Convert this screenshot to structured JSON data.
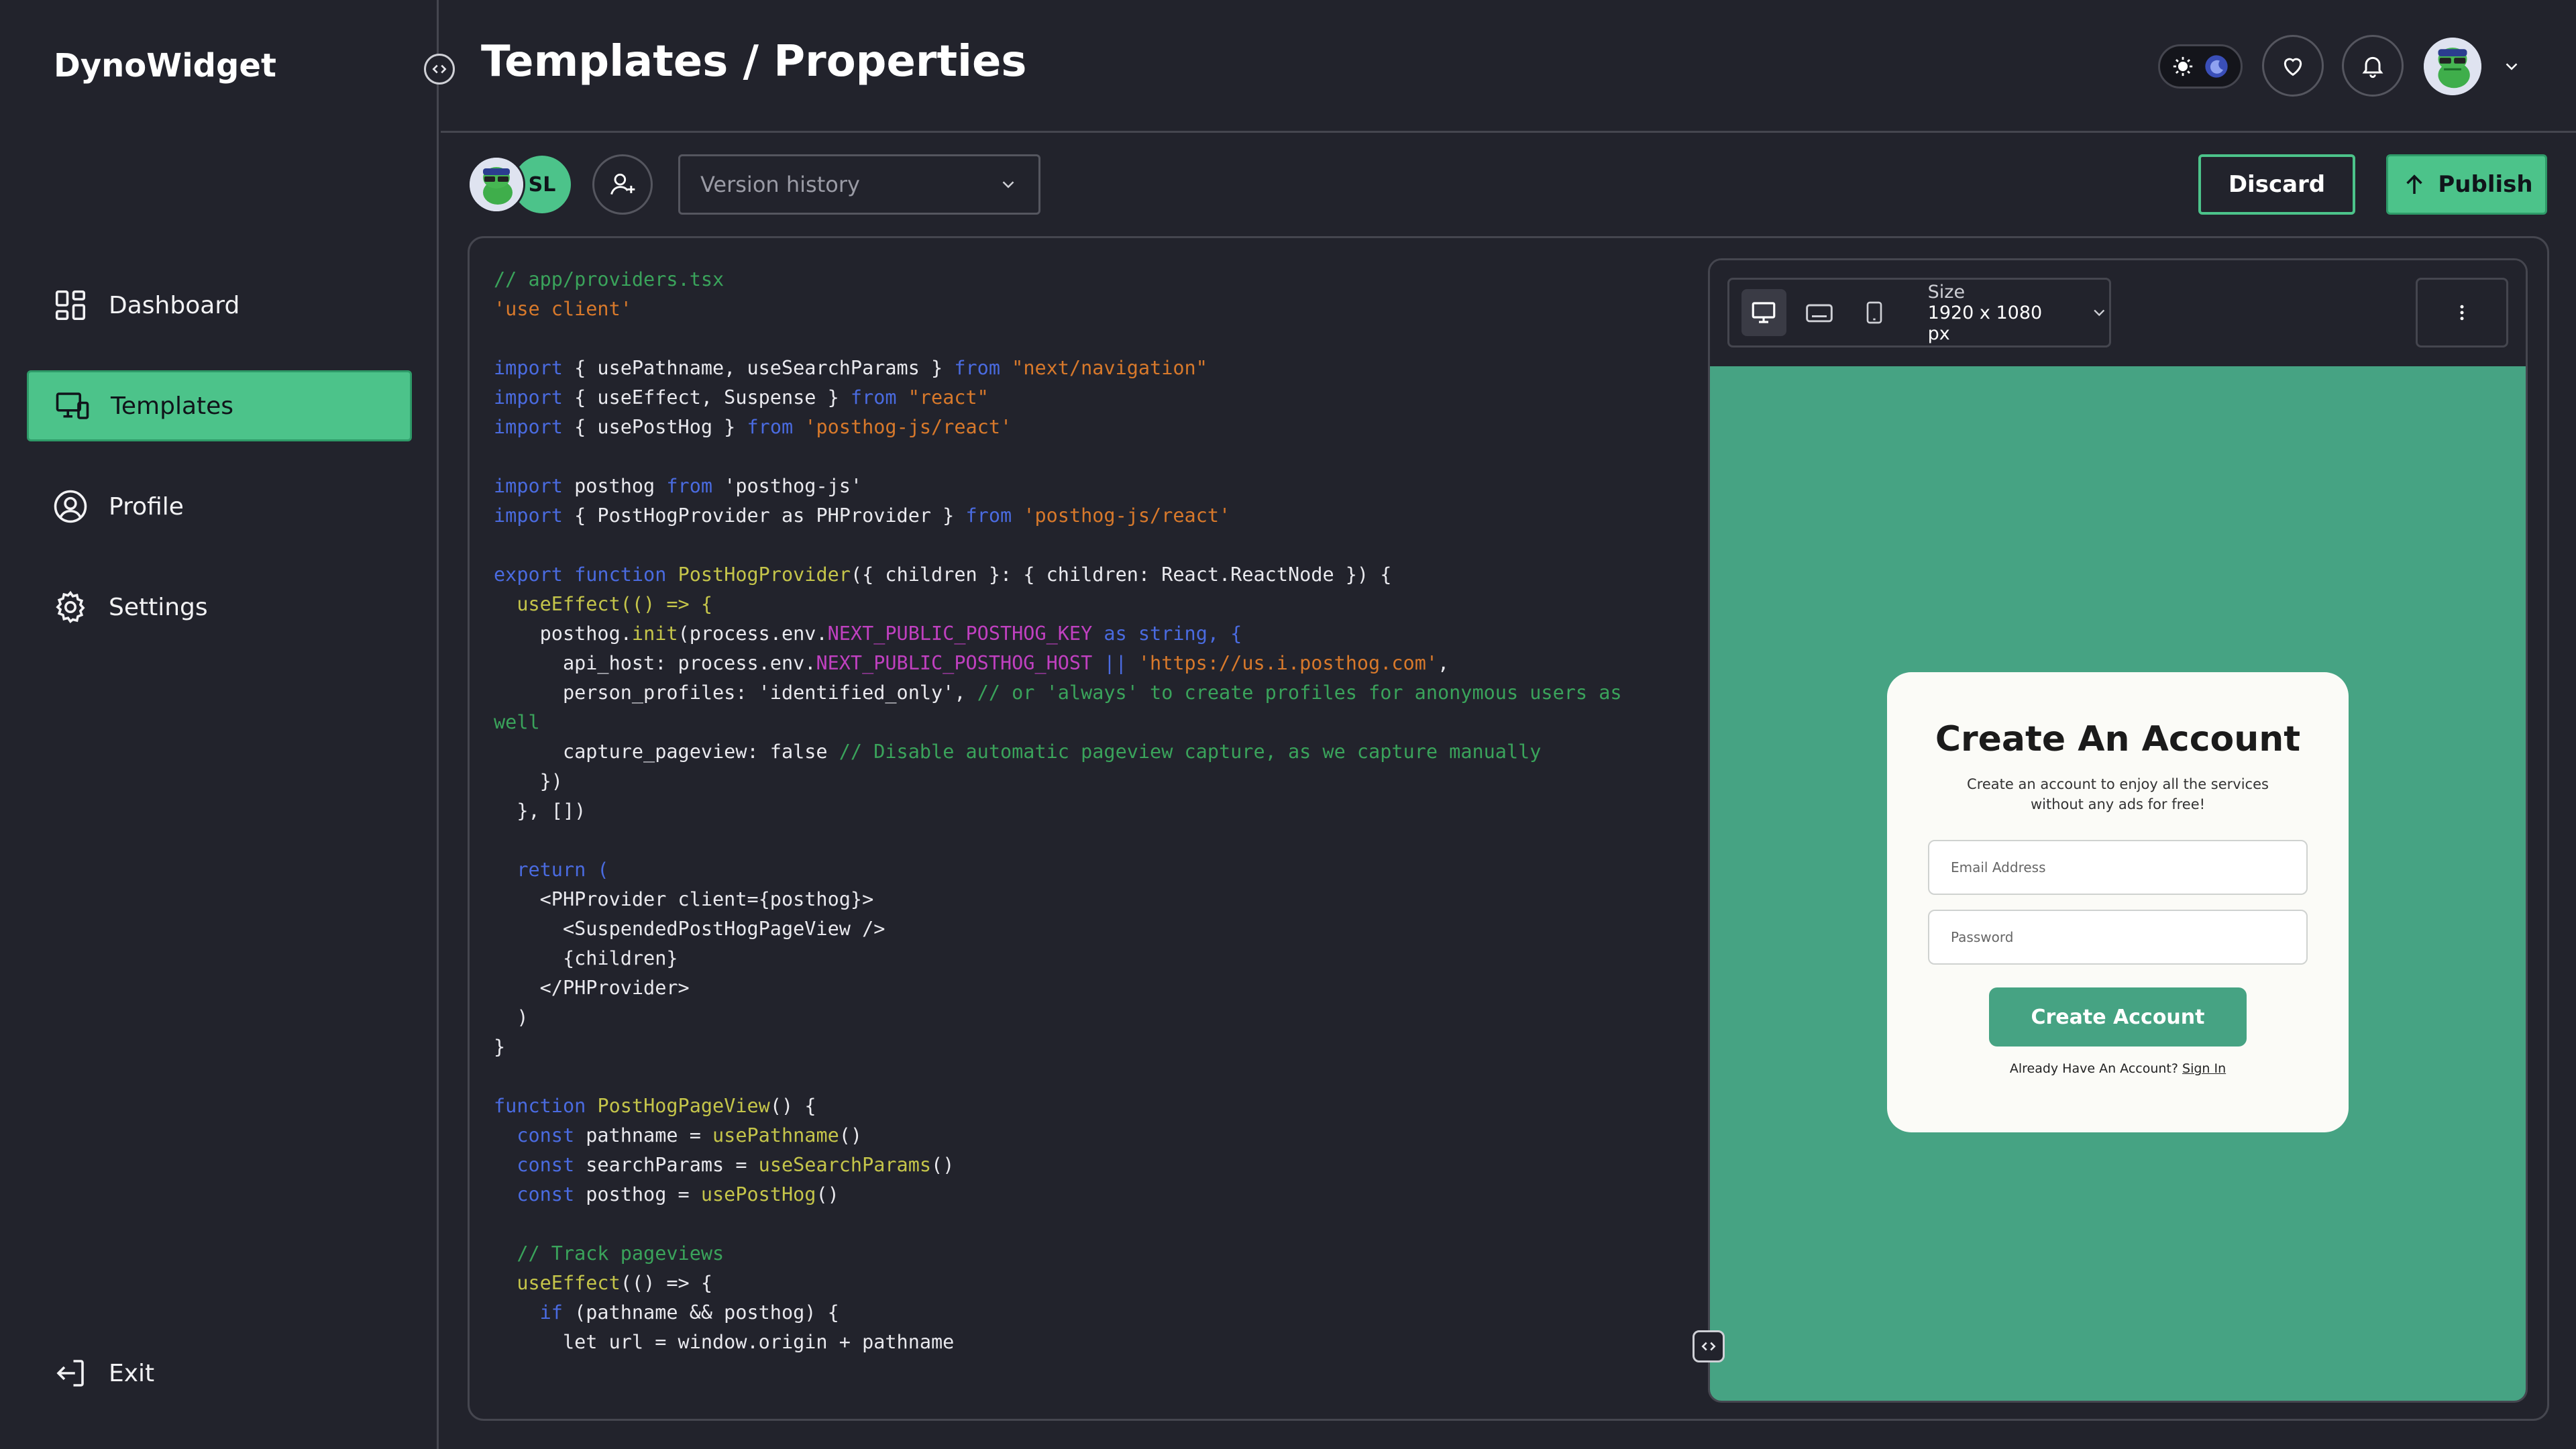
{
  "app": {
    "brand": "DynoWidget"
  },
  "sidebar": {
    "items": [
      {
        "label": "Dashboard",
        "icon": "dashboard-icon"
      },
      {
        "label": "Templates",
        "icon": "templates-icon",
        "active": true
      },
      {
        "label": "Profile",
        "icon": "profile-icon"
      },
      {
        "label": "Settings",
        "icon": "gear-icon"
      }
    ],
    "exit_label": "Exit"
  },
  "header": {
    "title": "Templates / Properties"
  },
  "toolbar": {
    "collaborator_initials": "SL",
    "version_history_placeholder": "Version history",
    "discard_label": "Discard",
    "publish_label": "Publish"
  },
  "preview": {
    "size_label": "Size",
    "size_value": "1920 x 1080 px",
    "card": {
      "title": "Create An Account",
      "subtitle": "Create an account to enjoy all the services without any ads for free!",
      "email_placeholder": "Email Address",
      "password_placeholder": "Password",
      "button_label": "Create Account",
      "footer_text": "Already Have An Account?",
      "footer_link": "Sign In"
    }
  },
  "colors": {
    "accent": "#4cc38a",
    "preview_bg": "#46a383",
    "bg": "#22232c"
  },
  "code_lines": [
    [
      [
        "// app/providers.tsx",
        "com"
      ]
    ],
    [
      [
        "'use client'",
        "str"
      ]
    ],
    [],
    [
      [
        "import",
        "key"
      ],
      [
        " { usePathname, useSearchParams } ",
        "def"
      ],
      [
        "from",
        "key"
      ],
      [
        " ",
        "def"
      ],
      [
        "\"next/navigation\"",
        "str"
      ]
    ],
    [
      [
        "import",
        "key"
      ],
      [
        " { useEffect, Suspense } ",
        "def"
      ],
      [
        "from",
        "key"
      ],
      [
        " ",
        "def"
      ],
      [
        "\"react\"",
        "str"
      ]
    ],
    [
      [
        "import",
        "key"
      ],
      [
        " { usePostHog } ",
        "def"
      ],
      [
        "from",
        "key"
      ],
      [
        " ",
        "def"
      ],
      [
        "'posthog-js/react'",
        "str"
      ]
    ],
    [],
    [
      [
        "import",
        "key"
      ],
      [
        " posthog ",
        "def"
      ],
      [
        "from",
        "key"
      ],
      [
        " 'posthog-js'",
        "def"
      ]
    ],
    [
      [
        "import",
        "key"
      ],
      [
        " { PostHogProvider as PHProvider } ",
        "def"
      ],
      [
        "from",
        "key"
      ],
      [
        " ",
        "def"
      ],
      [
        "'posthog-js/react'",
        "str"
      ]
    ],
    [],
    [
      [
        "export function",
        "key"
      ],
      [
        " ",
        "def"
      ],
      [
        "PostHogProvider",
        "fn"
      ],
      [
        "({ children }: { children: React.ReactNode }) {",
        "def"
      ]
    ],
    [
      [
        "  useEffect(() => {",
        "fn"
      ]
    ],
    [
      [
        "    posthog.",
        "def"
      ],
      [
        "init",
        "fn"
      ],
      [
        "(process.env.",
        "def"
      ],
      [
        "NEXT_PUBLIC_POSTHOG_KEY",
        "env"
      ],
      [
        " as string, {",
        "key"
      ]
    ],
    [
      [
        "      api_host: process.env.",
        "def"
      ],
      [
        "NEXT_PUBLIC_POSTHOG_HOST",
        "env"
      ],
      [
        " || ",
        "key"
      ],
      [
        "'https://us.i.posthog.com'",
        "str"
      ],
      [
        ",",
        "def"
      ]
    ],
    [
      [
        "      person_profiles: 'identified_only', ",
        "def"
      ],
      [
        "// or 'always' to create profiles for anonymous users as",
        "com"
      ]
    ],
    [
      [
        "well",
        "com"
      ]
    ],
    [
      [
        "      capture_pageview: false ",
        "def"
      ],
      [
        "// Disable automatic pageview capture, as we capture manually",
        "com"
      ]
    ],
    [
      [
        "    })",
        "def"
      ]
    ],
    [
      [
        "  }, [])",
        "def"
      ]
    ],
    [],
    [
      [
        "  return (",
        "key"
      ]
    ],
    [
      [
        "    <PHProvider client={posthog}>",
        "def"
      ]
    ],
    [
      [
        "      <SuspendedPostHogPageView />",
        "def"
      ]
    ],
    [
      [
        "      {children}",
        "def"
      ]
    ],
    [
      [
        "    </PHProvider>",
        "def"
      ]
    ],
    [
      [
        "  )",
        "def"
      ]
    ],
    [
      [
        "}",
        "def"
      ]
    ],
    [],
    [
      [
        "function",
        "key"
      ],
      [
        " ",
        "def"
      ],
      [
        "PostHogPageView",
        "fn"
      ],
      [
        "() {",
        "def"
      ]
    ],
    [
      [
        "  const",
        "key"
      ],
      [
        " pathname = ",
        "def"
      ],
      [
        "usePathname",
        "fn"
      ],
      [
        "()",
        "def"
      ]
    ],
    [
      [
        "  const",
        "key"
      ],
      [
        " searchParams = ",
        "def"
      ],
      [
        "useSearchParams",
        "fn"
      ],
      [
        "()",
        "def"
      ]
    ],
    [
      [
        "  const",
        "key"
      ],
      [
        " posthog = ",
        "def"
      ],
      [
        "usePostHog",
        "fn"
      ],
      [
        "()",
        "def"
      ]
    ],
    [],
    [
      [
        "  // Track pageviews",
        "com"
      ]
    ],
    [
      [
        "  useEffect",
        "fn"
      ],
      [
        "(() => {",
        "def"
      ]
    ],
    [
      [
        "    if",
        "key"
      ],
      [
        " (pathname && posthog) {",
        "def"
      ]
    ],
    [
      [
        "      let url = window.origin + pathname",
        "def"
      ]
    ]
  ]
}
